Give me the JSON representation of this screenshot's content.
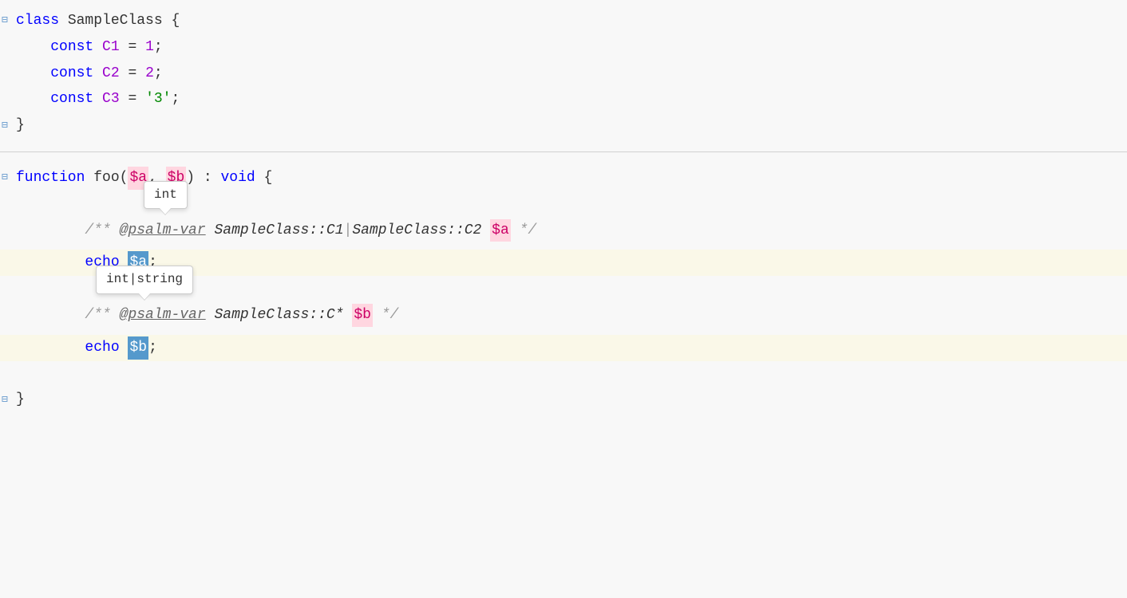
{
  "editor": {
    "background": "#f8f8f8",
    "sections": {
      "class_section": {
        "lines": [
          {
            "id": "class-decl",
            "has_fold": true,
            "content": "class SampleClass {"
          },
          {
            "id": "const-c1",
            "content": "    const C1 = 1;"
          },
          {
            "id": "const-c2",
            "content": "    const C2 = 2;"
          },
          {
            "id": "const-c3",
            "content": "    const C3 = '3';"
          },
          {
            "id": "class-close",
            "has_fold": true,
            "content": "}"
          }
        ]
      },
      "function_section": {
        "lines": [
          {
            "id": "func-decl",
            "has_fold": true,
            "content": "function foo($a, $b) : void {"
          },
          {
            "id": "comment-a",
            "content": "    /** @psalm-var SampleClass::C1|SampleClass::C2 $a */"
          },
          {
            "id": "tooltip-a",
            "tooltip_text": "int"
          },
          {
            "id": "echo-a",
            "content": "    echo $a;",
            "highlighted": true
          },
          {
            "id": "comment-b",
            "content": "    /** @psalm-var SampleClass::C* $b */"
          },
          {
            "id": "tooltip-b",
            "tooltip_text": "int|string"
          },
          {
            "id": "echo-b",
            "content": "    echo $b;",
            "highlighted": true
          },
          {
            "id": "func-close",
            "has_fold": true,
            "content": "}"
          }
        ]
      }
    },
    "tooltips": {
      "a": "int",
      "b": "int|string"
    },
    "labels": {
      "class_keyword": "class",
      "class_name": "SampleClass",
      "const_keyword": "const",
      "c1_name": "C1",
      "c1_val": "1",
      "c2_name": "C2",
      "c2_val": "2",
      "c3_name": "C3",
      "c3_val": "'3'",
      "function_keyword": "function",
      "func_name": "foo",
      "param_a": "$a",
      "param_b": "$b",
      "void_keyword": "void",
      "comment_prefix": "/**",
      "psalm_tag": "@psalm-var",
      "class_c1": "SampleClass::C1",
      "class_c2": "SampleClass::C2",
      "class_cstar": "SampleClass::C*",
      "comment_suffix": "*/",
      "echo_keyword": "echo"
    }
  }
}
